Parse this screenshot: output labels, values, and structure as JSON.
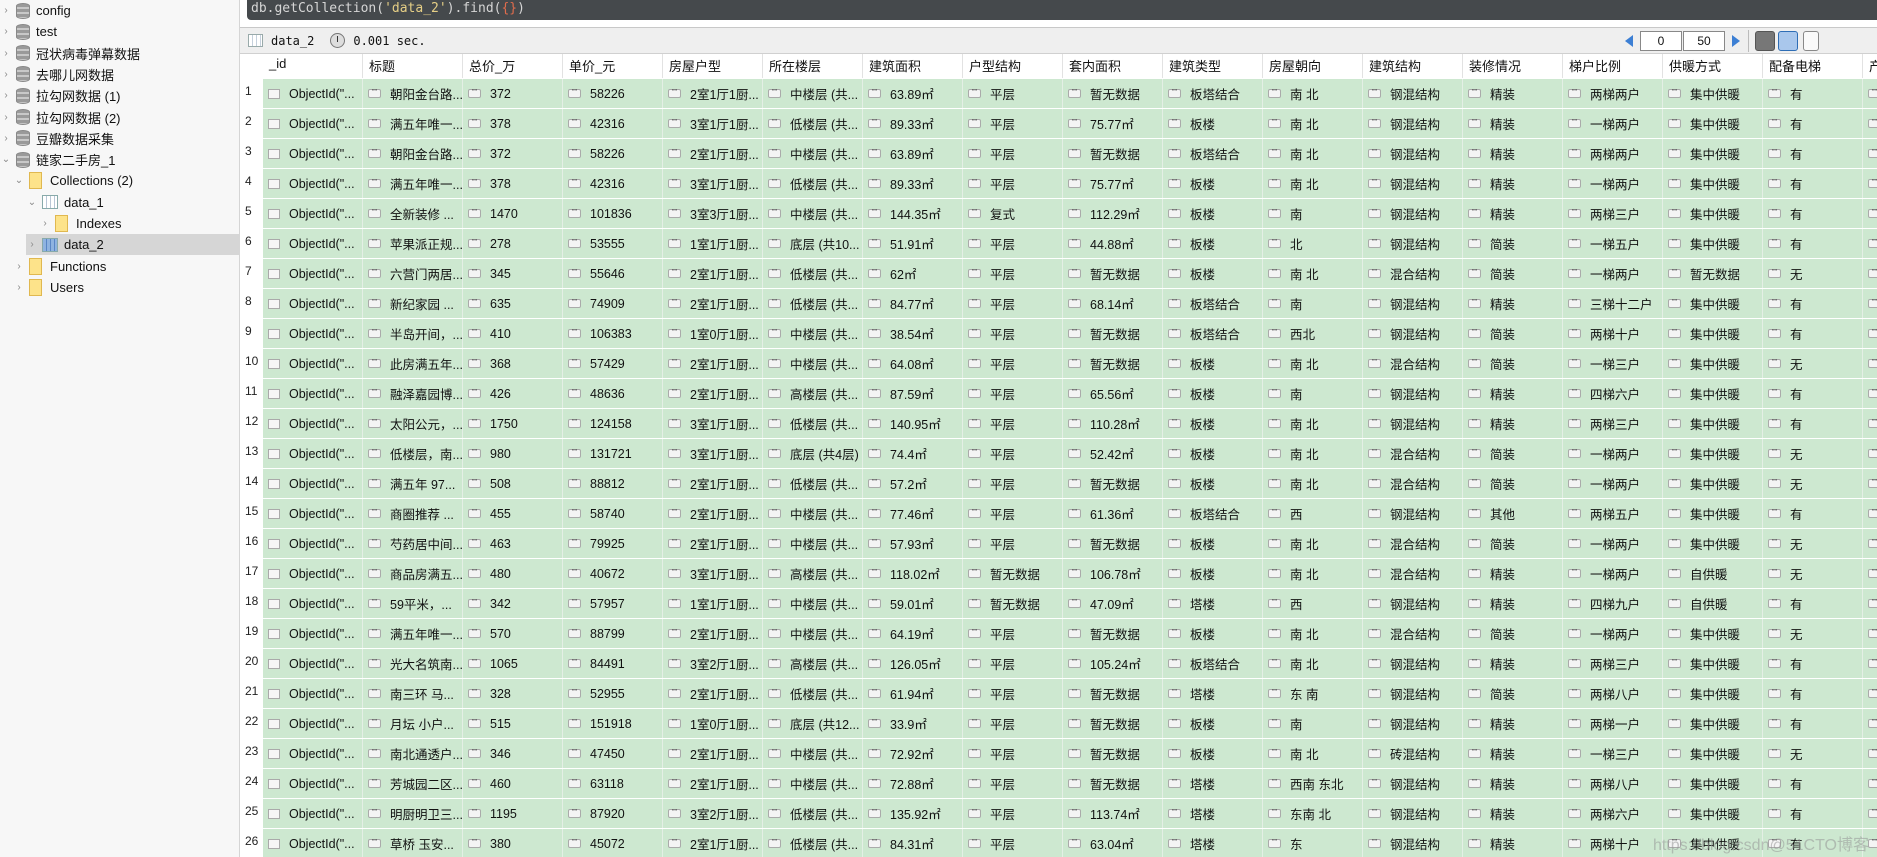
{
  "sidebar": {
    "items": [
      {
        "label": "config",
        "type": "db",
        "level": 0,
        "expanded": false
      },
      {
        "label": "test",
        "type": "db",
        "level": 0,
        "expanded": false
      },
      {
        "label": "冠状病毒弹幕数据",
        "type": "db",
        "level": 0,
        "expanded": false
      },
      {
        "label": "去哪儿网数据",
        "type": "db",
        "level": 0,
        "expanded": false
      },
      {
        "label": "拉勾网数据 (1)",
        "type": "db",
        "level": 0,
        "expanded": false
      },
      {
        "label": "拉勾网数据 (2)",
        "type": "db",
        "level": 0,
        "expanded": false
      },
      {
        "label": "豆瓣数据采集",
        "type": "db",
        "level": 0,
        "expanded": false
      },
      {
        "label": "链家二手房_1",
        "type": "db",
        "level": 0,
        "expanded": true
      },
      {
        "label": "Collections (2)",
        "type": "folder",
        "level": 1,
        "expanded": true
      },
      {
        "label": "data_1",
        "type": "collection",
        "level": 2,
        "expanded": true
      },
      {
        "label": "Indexes",
        "type": "folder",
        "level": 3,
        "expanded": false
      },
      {
        "label": "data_2",
        "type": "collection",
        "level": 2,
        "expanded": false,
        "selected": true
      },
      {
        "label": "Functions",
        "type": "folder",
        "level": 1,
        "expanded": false
      },
      {
        "label": "Users",
        "type": "folder",
        "level": 1,
        "expanded": false
      }
    ]
  },
  "query": {
    "prefix": "db.getCollection(",
    "arg": "'data_2'",
    "mid": ").find(",
    "brace": "{}",
    "suffix": ")"
  },
  "toolbar": {
    "collection": "data_2",
    "time": "0.001 sec.",
    "skip": "0",
    "limit": "50"
  },
  "table": {
    "columns": [
      "_id",
      "标题",
      "总价_万",
      "单价_元",
      "房屋户型",
      "所在楼层",
      "建筑面积",
      "户型结构",
      "套内面积",
      "建筑类型",
      "房屋朝向",
      "建筑结构",
      "装修情况",
      "梯户比例",
      "供暖方式",
      "配备电梯",
      "产"
    ],
    "rows": [
      [
        "ObjectId(\"...",
        "朝阳金台路...",
        "372",
        "58226",
        "2室1厅1厨...",
        "中楼层 (共...",
        "63.89㎡",
        "平层",
        "暂无数据",
        "板塔结合",
        "南 北",
        "钢混结构",
        "精装",
        "两梯两户",
        "集中供暖",
        "有",
        ""
      ],
      [
        "ObjectId(\"...",
        "满五年唯一...",
        "378",
        "42316",
        "3室1厅1厨...",
        "低楼层 (共...",
        "89.33㎡",
        "平层",
        "75.77㎡",
        "板楼",
        "南 北",
        "钢混结构",
        "精装",
        "一梯两户",
        "集中供暖",
        "有",
        ""
      ],
      [
        "ObjectId(\"...",
        "朝阳金台路...",
        "372",
        "58226",
        "2室1厅1厨...",
        "中楼层 (共...",
        "63.89㎡",
        "平层",
        "暂无数据",
        "板塔结合",
        "南 北",
        "钢混结构",
        "精装",
        "两梯两户",
        "集中供暖",
        "有",
        ""
      ],
      [
        "ObjectId(\"...",
        "满五年唯一...",
        "378",
        "42316",
        "3室1厅1厨...",
        "低楼层 (共...",
        "89.33㎡",
        "平层",
        "75.77㎡",
        "板楼",
        "南 北",
        "钢混结构",
        "精装",
        "一梯两户",
        "集中供暖",
        "有",
        ""
      ],
      [
        "ObjectId(\"...",
        "全新装修 ...",
        "1470",
        "101836",
        "3室3厅1厨...",
        "中楼层 (共...",
        "144.35㎡",
        "复式",
        "112.29㎡",
        "板楼",
        "南",
        "钢混结构",
        "精装",
        "两梯三户",
        "集中供暖",
        "有",
        ""
      ],
      [
        "ObjectId(\"...",
        "苹果派正规...",
        "278",
        "53555",
        "1室1厅1厨...",
        "底层 (共10...",
        "51.91㎡",
        "平层",
        "44.88㎡",
        "板楼",
        "北",
        "钢混结构",
        "简装",
        "一梯五户",
        "集中供暖",
        "有",
        ""
      ],
      [
        "ObjectId(\"...",
        "六营门两居...",
        "345",
        "55646",
        "2室1厅1厨...",
        "低楼层 (共...",
        "62㎡",
        "平层",
        "暂无数据",
        "板楼",
        "南 北",
        "混合结构",
        "简装",
        "一梯两户",
        "暂无数据",
        "无",
        ""
      ],
      [
        "ObjectId(\"...",
        "新纪家园 ...",
        "635",
        "74909",
        "2室1厅1厨...",
        "低楼层 (共...",
        "84.77㎡",
        "平层",
        "68.14㎡",
        "板塔结合",
        "南",
        "钢混结构",
        "精装",
        "三梯十二户",
        "集中供暖",
        "有",
        ""
      ],
      [
        "ObjectId(\"...",
        "半岛开间，...",
        "410",
        "106383",
        "1室0厅1厨...",
        "中楼层 (共...",
        "38.54㎡",
        "平层",
        "暂无数据",
        "板塔结合",
        "西北",
        "钢混结构",
        "简装",
        "两梯十户",
        "集中供暖",
        "有",
        ""
      ],
      [
        "ObjectId(\"...",
        "此房满五年...",
        "368",
        "57429",
        "2室1厅1厨...",
        "中楼层 (共...",
        "64.08㎡",
        "平层",
        "暂无数据",
        "板楼",
        "南 北",
        "混合结构",
        "简装",
        "一梯三户",
        "集中供暖",
        "无",
        ""
      ],
      [
        "ObjectId(\"...",
        "融泽嘉园博...",
        "426",
        "48636",
        "2室1厅1厨...",
        "高楼层 (共...",
        "87.59㎡",
        "平层",
        "65.56㎡",
        "板楼",
        "南",
        "钢混结构",
        "精装",
        "四梯六户",
        "集中供暖",
        "有",
        ""
      ],
      [
        "ObjectId(\"...",
        "太阳公元，...",
        "1750",
        "124158",
        "3室1厅1厨...",
        "低楼层 (共...",
        "140.95㎡",
        "平层",
        "110.28㎡",
        "板楼",
        "南 北",
        "钢混结构",
        "精装",
        "两梯三户",
        "集中供暖",
        "有",
        ""
      ],
      [
        "ObjectId(\"...",
        "低楼层，南...",
        "980",
        "131721",
        "3室1厅1厨...",
        "底层 (共4层)",
        "74.4㎡",
        "平层",
        "52.42㎡",
        "板楼",
        "南 北",
        "混合结构",
        "简装",
        "一梯两户",
        "集中供暖",
        "无",
        ""
      ],
      [
        "ObjectId(\"...",
        "满五年  97...",
        "508",
        "88812",
        "2室1厅1厨...",
        "低楼层 (共...",
        "57.2㎡",
        "平层",
        "暂无数据",
        "板楼",
        "南 北",
        "混合结构",
        "简装",
        "一梯两户",
        "集中供暖",
        "无",
        ""
      ],
      [
        "ObjectId(\"...",
        "商圈推荐 ...",
        "455",
        "58740",
        "2室1厅1厨...",
        "中楼层 (共...",
        "77.46㎡",
        "平层",
        "61.36㎡",
        "板塔结合",
        "西",
        "钢混结构",
        "其他",
        "两梯五户",
        "集中供暖",
        "有",
        ""
      ],
      [
        "ObjectId(\"...",
        "芍药居中间...",
        "463",
        "79925",
        "2室1厅1厨...",
        "中楼层 (共...",
        "57.93㎡",
        "平层",
        "暂无数据",
        "板楼",
        "南 北",
        "混合结构",
        "简装",
        "一梯两户",
        "集中供暖",
        "无",
        ""
      ],
      [
        "ObjectId(\"...",
        "商品房满五...",
        "480",
        "40672",
        "3室1厅1厨...",
        "高楼层 (共...",
        "118.02㎡",
        "暂无数据",
        "106.78㎡",
        "板楼",
        "南 北",
        "混合结构",
        "精装",
        "一梯两户",
        "自供暖",
        "无",
        ""
      ],
      [
        "ObjectId(\"...",
        "59平米，...",
        "342",
        "57957",
        "1室1厅1厨...",
        "中楼层 (共...",
        "59.01㎡",
        "暂无数据",
        "47.09㎡",
        "塔楼",
        "西",
        "钢混结构",
        "精装",
        "四梯九户",
        "自供暖",
        "有",
        ""
      ],
      [
        "ObjectId(\"...",
        "满五年唯一...",
        "570",
        "88799",
        "2室1厅1厨...",
        "中楼层 (共...",
        "64.19㎡",
        "平层",
        "暂无数据",
        "板楼",
        "南 北",
        "混合结构",
        "简装",
        "一梯两户",
        "集中供暖",
        "无",
        ""
      ],
      [
        "ObjectId(\"...",
        "光大名筑南...",
        "1065",
        "84491",
        "3室2厅1厨...",
        "高楼层 (共...",
        "126.05㎡",
        "平层",
        "105.24㎡",
        "板塔结合",
        "南 北",
        "钢混结构",
        "精装",
        "两梯三户",
        "集中供暖",
        "有",
        ""
      ],
      [
        "ObjectId(\"...",
        "南三环 马...",
        "328",
        "52955",
        "2室1厅1厨...",
        "低楼层 (共...",
        "61.94㎡",
        "平层",
        "暂无数据",
        "塔楼",
        "东 南",
        "钢混结构",
        "简装",
        "两梯八户",
        "集中供暖",
        "有",
        ""
      ],
      [
        "ObjectId(\"...",
        "月坛 小户...",
        "515",
        "151918",
        "1室0厅1厨...",
        "底层 (共12...",
        "33.9㎡",
        "平层",
        "暂无数据",
        "板楼",
        "南",
        "钢混结构",
        "精装",
        "两梯一户",
        "集中供暖",
        "有",
        ""
      ],
      [
        "ObjectId(\"...",
        "南北通透户...",
        "346",
        "47450",
        "2室1厅1厨...",
        "中楼层 (共...",
        "72.92㎡",
        "平层",
        "暂无数据",
        "板楼",
        "南 北",
        "砖混结构",
        "精装",
        "一梯三户",
        "集中供暖",
        "无",
        ""
      ],
      [
        "ObjectId(\"...",
        "芳城园二区...",
        "460",
        "63118",
        "2室1厅1厨...",
        "中楼层 (共...",
        "72.88㎡",
        "平层",
        "暂无数据",
        "塔楼",
        "西南 东北",
        "钢混结构",
        "精装",
        "两梯八户",
        "集中供暖",
        "有",
        ""
      ],
      [
        "ObjectId(\"...",
        "明厨明卫三...",
        "1195",
        "87920",
        "3室2厅1厨...",
        "低楼层 (共...",
        "135.92㎡",
        "平层",
        "113.74㎡",
        "塔楼",
        "东南 北",
        "钢混结构",
        "精装",
        "两梯六户",
        "集中供暖",
        "有",
        ""
      ],
      [
        "ObjectId(\"...",
        "草桥 玉安...",
        "380",
        "45072",
        "2室1厅1厨...",
        "低楼层 (共...",
        "84.31㎡",
        "平层",
        "63.04㎡",
        "塔楼",
        "东",
        "钢混结构",
        "精装",
        "两梯十户",
        "集中供暖",
        "有",
        ""
      ]
    ]
  },
  "watermark": "https://blog.csdn@51CTO博客",
  "colors": {
    "row_bg": "#cde8d0",
    "query_bg": "#45494c",
    "selected_bg": "#d6d6d6"
  }
}
